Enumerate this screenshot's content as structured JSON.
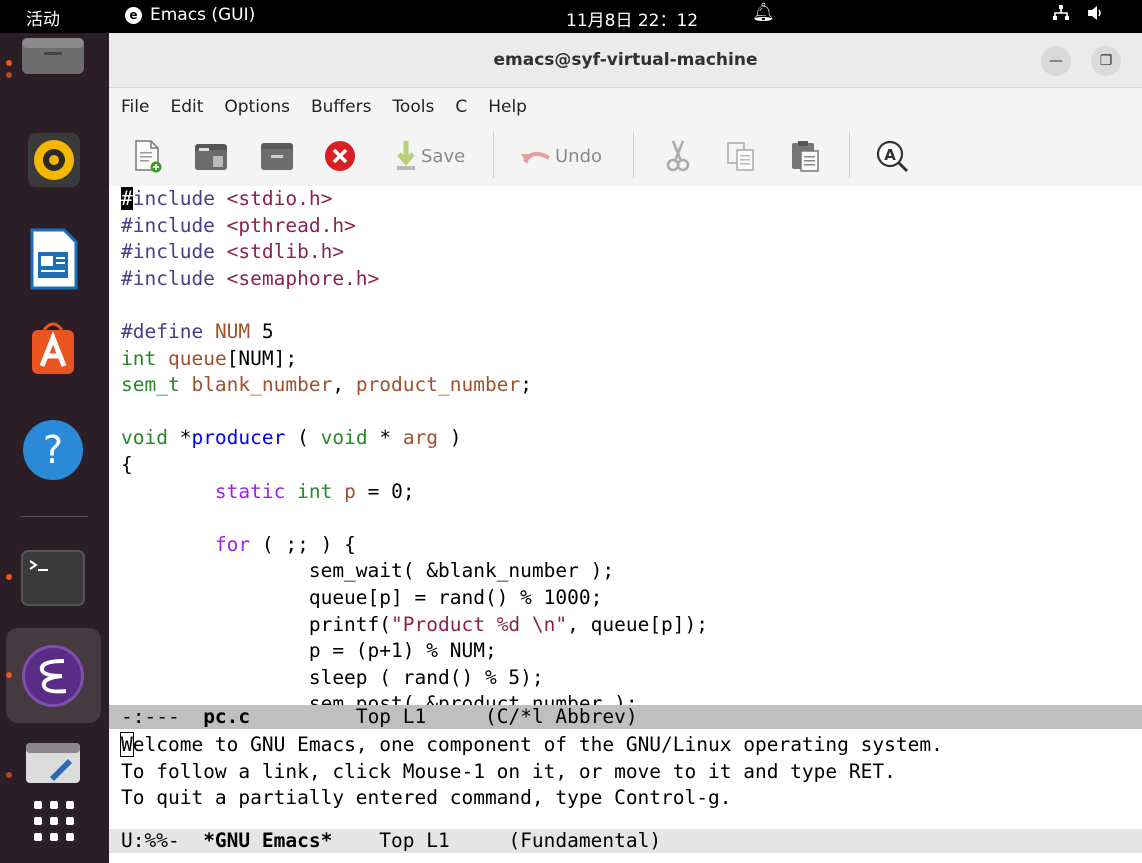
{
  "topbar": {
    "activities": "活动",
    "app_name": "Emacs (GUI)",
    "clock": "11月8日  22：12",
    "icons": [
      "bell-icon",
      "network-icon",
      "volume-icon"
    ]
  },
  "dock": {
    "items": [
      "files",
      "rhythmbox",
      "libreoffice-writer",
      "app-center",
      "help",
      "terminal",
      "emacs",
      "text-editor",
      "show-apps"
    ]
  },
  "window": {
    "title": "emacs@syf-virtual-machine",
    "minimize": "—",
    "maximize": "❐"
  },
  "menubar": {
    "items": [
      "File",
      "Edit",
      "Options",
      "Buffers",
      "Tools",
      "C",
      "Help"
    ]
  },
  "toolbar": {
    "save_label": "Save",
    "undo_label": "Undo"
  },
  "editor": {
    "lines": [
      "#include <stdio.h>",
      "#include <pthread.h>",
      "#include <stdlib.h>",
      "#include <semaphore.h>",
      "",
      "#define NUM 5",
      "int queue[NUM];",
      "sem_t blank_number, product_number;",
      "",
      "void *producer ( void * arg )",
      "{",
      "        static int p = 0;",
      "",
      "        for ( ;; ) {",
      "                sem_wait( &blank_number );",
      "                queue[p] = rand() % 1000;",
      "                printf(\"Product %d \\n\", queue[p]);",
      "                p = (p+1) % NUM;",
      "                sleep ( rand() % 5);",
      "                sem_post( &product_number );"
    ]
  },
  "modeline1": {
    "status": "-:---",
    "buffer": "pc.c",
    "position": "Top L1",
    "mode": "(C/*l Abbrev)"
  },
  "echo": {
    "lines": [
      "Welcome to GNU Emacs, one component of the GNU/Linux operating system.",
      "To follow a link, click Mouse-1 on it, or move to it and type RET.",
      "To quit a partially entered command, type Control-g."
    ]
  },
  "modeline2": {
    "status": "U:%%-",
    "buffer": "*GNU Emacs*",
    "position": "Top L1",
    "mode": "(Fundamental)"
  },
  "colors": {
    "keyword": "#a020f0",
    "type": "#228b22",
    "function": "#0000ff",
    "variable": "#a0522d",
    "string": "#8b2252",
    "dock_bg": "#2b1e26"
  }
}
